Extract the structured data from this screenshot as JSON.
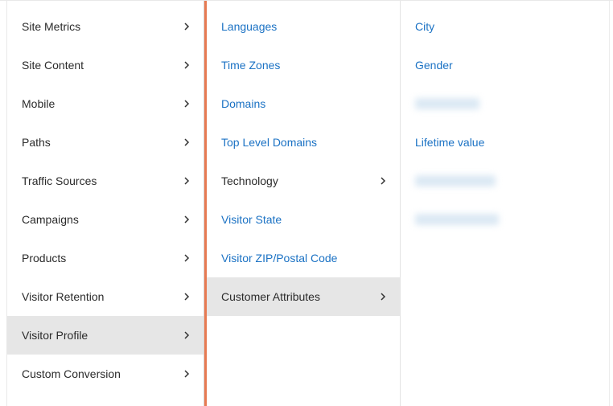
{
  "col1": {
    "items": [
      {
        "label": "Site Metrics",
        "selected": false
      },
      {
        "label": "Site Content",
        "selected": false
      },
      {
        "label": "Mobile",
        "selected": false
      },
      {
        "label": "Paths",
        "selected": false
      },
      {
        "label": "Traffic Sources",
        "selected": false
      },
      {
        "label": "Campaigns",
        "selected": false
      },
      {
        "label": "Products",
        "selected": false
      },
      {
        "label": "Visitor Retention",
        "selected": false
      },
      {
        "label": "Visitor Profile",
        "selected": true
      },
      {
        "label": "Custom Conversion",
        "selected": false
      }
    ]
  },
  "col2": {
    "items": [
      {
        "label": "Languages",
        "type": "link",
        "selected": false
      },
      {
        "label": "Time Zones",
        "type": "link",
        "selected": false
      },
      {
        "label": "Domains",
        "type": "link",
        "selected": false
      },
      {
        "label": "Top Level Domains",
        "type": "link",
        "selected": false
      },
      {
        "label": "Technology",
        "type": "expandable",
        "selected": false
      },
      {
        "label": "Visitor State",
        "type": "link",
        "selected": false
      },
      {
        "label": "Visitor ZIP/Postal Code",
        "type": "link",
        "selected": false
      },
      {
        "label": "Customer Attributes",
        "type": "expandable",
        "selected": true
      }
    ]
  },
  "col3": {
    "items": [
      {
        "label": "City",
        "type": "link"
      },
      {
        "label": "Gender",
        "type": "link"
      },
      {
        "label": "",
        "type": "blurred",
        "width": "bw-80"
      },
      {
        "label": "Lifetime value",
        "type": "link"
      },
      {
        "label": "",
        "type": "blurred",
        "width": "bw-100"
      },
      {
        "label": "",
        "type": "blurred",
        "width": "bw-104"
      }
    ]
  }
}
